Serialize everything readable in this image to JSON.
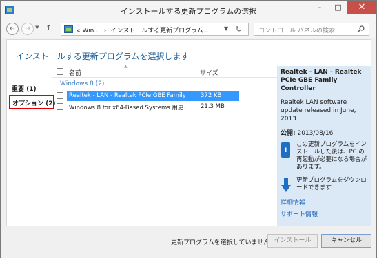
{
  "window": {
    "title": "インストールする更新プログラムの選択",
    "minimize_glyph": "–",
    "maximize_glyph": "□",
    "close_glyph": "✕"
  },
  "addressbar": {
    "back_glyph": "←",
    "forward_glyph": "→",
    "up_glyph": "↑",
    "breadcrumb_prefix": "«",
    "breadcrumb_parent": "Win...",
    "breadcrumb_current": "インストールする更新プログラム...",
    "search_placeholder": "コントロール パネルの検索"
  },
  "content": {
    "heading": "インストールする更新プログラムを選択します"
  },
  "categories": {
    "important": "重要 (1)",
    "optional": "オプション (2)"
  },
  "list": {
    "column_name": "名前",
    "column_size": "サイズ",
    "group_label": "Windows 8 (2)",
    "rows": [
      {
        "name": "Realtek - LAN - Realtek PCIe GBE Family ...",
        "size": "372 KB",
        "selected": true
      },
      {
        "name": "Windows 8 for x64-Based Systems 用更...",
        "size": "21.3 MB",
        "selected": false
      }
    ]
  },
  "details": {
    "title": "Realtek - LAN - Realtek PCIe GBE Family Controller",
    "description": "Realtek LAN software update released in June, 2013",
    "published_label": "公開:",
    "published_date": "2013/08/16",
    "note": "この更新プログラムをインストールした後は、PC の再起動が必要になる場合があります。",
    "download_note": "更新プログラムをダウンロードできます",
    "link_details": "詳細情報",
    "link_support": "サポート情報"
  },
  "footer": {
    "status": "更新プログラムを選択していません。",
    "install_button": "インストール",
    "cancel_button": "キャンセル"
  },
  "colors": {
    "accent": "#1c5e96",
    "selection": "#3399ff",
    "highlight_border": "#e10000",
    "detail_pane": "#dbe8f6",
    "close_button": "#c7504b"
  }
}
